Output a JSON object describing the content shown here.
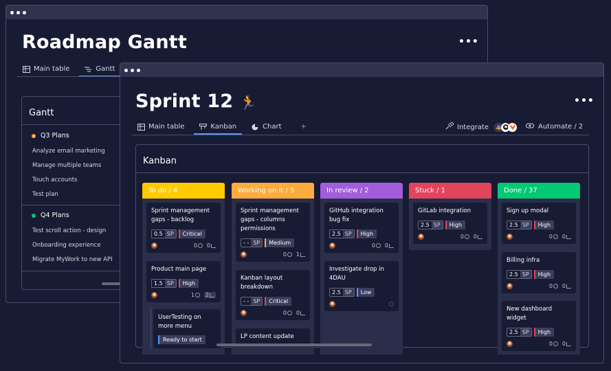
{
  "back_window": {
    "title": "Roadmap Gantt",
    "more": "•••",
    "tabs": [
      {
        "label": "Main table"
      },
      {
        "label": "Gantt"
      }
    ],
    "panel_title": "Gantt",
    "groups": [
      {
        "name": "Q3 Plans",
        "color": "#fdab3d",
        "items": [
          "Analyze email marketing",
          "Manage multiple teams",
          "Touch accounts",
          "Test plan"
        ]
      },
      {
        "name": "Q4 Plans",
        "color": "#00c875",
        "items": [
          "Test scroll action - design",
          "Onboarding experience",
          "Migrate MyWork to new API"
        ]
      }
    ]
  },
  "front_window": {
    "title": "Sprint 12",
    "title_emoji": "🏃",
    "more": "•••",
    "tabs": [
      {
        "label": "Main table"
      },
      {
        "label": "Kanban"
      },
      {
        "label": "Chart"
      }
    ],
    "add_tab": "+",
    "integrate_label": "Integrate",
    "automate_label": "Automate / 2",
    "panel_title": "Kanban",
    "columns": [
      {
        "label": "To do / 4",
        "color": "#ffcb00",
        "cards": [
          {
            "title": "Sprint management gaps - backlog",
            "sp": "0.5",
            "sp_label": "SP",
            "tag": "Critical",
            "tag_color": "#e2445c",
            "updates": "0",
            "subitems": "0"
          },
          {
            "title": "Product main page",
            "sp": "1.5",
            "sp_label": "SP",
            "tag": "High",
            "tag_color": "#e2445c",
            "updates": "1",
            "subitems": "2"
          }
        ],
        "subitem": {
          "title": "UserTesting on more menu",
          "status": "Ready to start",
          "status_color": "#579bfc"
        }
      },
      {
        "label": "Working on it / 5",
        "color": "#fdab3d",
        "cards": [
          {
            "title": "Sprint management gaps - columns permissions",
            "sp": "- -",
            "sp_label": "SP",
            "tag": "Medium",
            "tag_color": "#fdab3d",
            "updates": "0",
            "subitems": "1"
          },
          {
            "title": "Kanban layout breakdown",
            "sp": "- -",
            "sp_label": "SP",
            "tag": "Critical",
            "tag_color": "#e2445c",
            "updates": "0",
            "subitems": "0"
          },
          {
            "title": "LP content update"
          }
        ]
      },
      {
        "label": "In review / 2",
        "color": "#a25ddc",
        "cards": [
          {
            "title": "GitHub integration bug fix",
            "sp": "2.5",
            "sp_label": "SP",
            "tag": "High",
            "tag_color": "#e2445c",
            "updates": "0",
            "subitems": "0"
          },
          {
            "title": "Investigate drop in 4DAU",
            "sp": "2.5",
            "sp_label": "SP",
            "tag": "Low",
            "tag_color": "#579bfc",
            "updates": "",
            "subitems": ""
          }
        ]
      },
      {
        "label": "Stuck / 1",
        "color": "#e2445c",
        "cards": [
          {
            "title": "GitLab integration",
            "sp": "2.5",
            "sp_label": "SP",
            "tag": "High",
            "tag_color": "#e2445c",
            "updates": "0",
            "subitems": "0"
          }
        ]
      },
      {
        "label": "Done  / 37",
        "color": "#00c875",
        "cards": [
          {
            "title": "Sign up modal",
            "sp": "2.5",
            "sp_label": "SP",
            "tag": "High",
            "tag_color": "#e2445c",
            "updates": "0",
            "subitems": "0"
          },
          {
            "title": "Billing infra",
            "sp": "2.5",
            "sp_label": "SP",
            "tag": "High",
            "tag_color": "#e2445c",
            "updates": "0",
            "subitems": "0"
          },
          {
            "title": "New dashboard widget",
            "sp": "2.5",
            "sp_label": "SP",
            "tag": "High",
            "tag_color": "#e2445c",
            "updates": "0",
            "subitems": "0"
          }
        ]
      }
    ]
  }
}
